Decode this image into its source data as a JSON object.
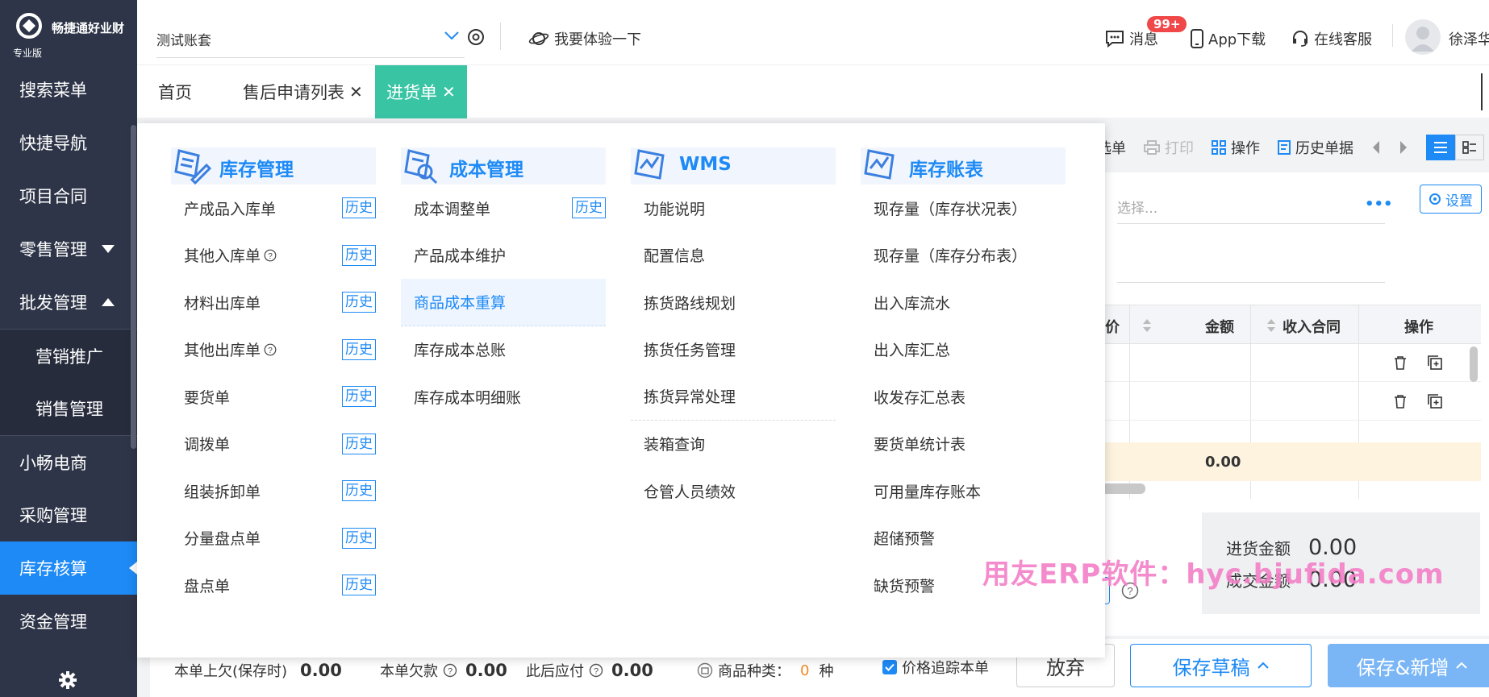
{
  "app": {
    "name": "畅捷通好业财",
    "edition": "专业版"
  },
  "sidebar": {
    "items": [
      {
        "label": "搜索菜单"
      },
      {
        "label": "快捷导航"
      },
      {
        "label": "项目合同"
      },
      {
        "label": "零售管理"
      },
      {
        "label": "批发管理"
      },
      {
        "label": "营销推广"
      },
      {
        "label": "销售管理"
      },
      {
        "label": "小畅电商"
      },
      {
        "label": "采购管理"
      },
      {
        "label": "库存核算"
      },
      {
        "label": "资金管理"
      }
    ]
  },
  "header": {
    "account": "测试账套",
    "try_label": "我要体验一下",
    "messages_label": "消息",
    "messages_badge": "99+",
    "app_download": "App下载",
    "online_service": "在线客服",
    "username": "徐泽华"
  },
  "tabs": [
    {
      "label": "首页"
    },
    {
      "label": "售后申请列表"
    },
    {
      "label": "进货单"
    }
  ],
  "toolbar": {
    "select": "选单",
    "print": "打印",
    "operate": "操作",
    "history": "历史单据"
  },
  "form": {
    "select_placeholder": "选择...",
    "settings_label": "设置"
  },
  "grid": {
    "columns": [
      "价",
      "金额",
      "收入合同",
      "操作"
    ],
    "total": "0.00"
  },
  "summary": {
    "purchase_amount_label": "进货金额",
    "purchase_amount": "0.00",
    "deal_amount_label": "成交金额",
    "deal_amount": "0.00"
  },
  "footer": {
    "prev_owed_label": "本单上欠(保存时)",
    "prev_owed": "0.00",
    "owed_label": "本单欠款",
    "owed": "0.00",
    "payable_label": "此后应付",
    "payable": "0.00",
    "kinds_label": "商品种类：",
    "kinds_count": "0",
    "kinds_unit": "种",
    "price_track_label": "价格追踪本单",
    "abandon": "放弃",
    "save_draft": "保存草稿",
    "save_new": "保存&新增"
  },
  "mega_menu": {
    "history_label": "历史",
    "columns": [
      {
        "title": "库存管理",
        "items": [
          {
            "label": "产成品入库单",
            "history": true
          },
          {
            "label": "其他入库单",
            "history": true,
            "help": true
          },
          {
            "label": "材料出库单",
            "history": true
          },
          {
            "label": "其他出库单",
            "history": true,
            "help": true
          },
          {
            "label": "要货单",
            "history": true
          },
          {
            "label": "调拨单",
            "history": true
          },
          {
            "label": "组装拆卸单",
            "history": true
          },
          {
            "label": "分量盘点单",
            "history": true
          },
          {
            "label": "盘点单",
            "history": true
          }
        ]
      },
      {
        "title": "成本管理",
        "items": [
          {
            "label": "成本调整单",
            "history": true
          },
          {
            "label": "产品成本维护"
          },
          {
            "label": "商品成本重算",
            "highlight": true
          },
          {
            "label": "库存成本总账"
          },
          {
            "label": "库存成本明细账"
          }
        ]
      },
      {
        "title": "WMS",
        "items": [
          {
            "label": "功能说明"
          },
          {
            "label": "配置信息"
          },
          {
            "label": "拣货路线规划"
          },
          {
            "label": "拣货任务管理"
          },
          {
            "label": "拣货异常处理",
            "separator": true
          },
          {
            "label": "装箱查询"
          },
          {
            "label": "仓管人员绩效"
          }
        ]
      },
      {
        "title": "库存账表",
        "items": [
          {
            "label": "现存量（库存状况表）"
          },
          {
            "label": "现存量（库存分布表）"
          },
          {
            "label": "出入库流水"
          },
          {
            "label": "出入库汇总"
          },
          {
            "label": "收发存汇总表"
          },
          {
            "label": "要货单统计表"
          },
          {
            "label": "可用量库存账本"
          },
          {
            "label": "超储预警"
          },
          {
            "label": "缺货预警"
          }
        ]
      }
    ]
  },
  "watermark": "用友ERP软件：hyc.bjufida.com",
  "colors": {
    "primary": "#1e8af5",
    "active_tab": "#39c4a4",
    "sidebar": "#2e3548",
    "badge": "#f04848"
  }
}
